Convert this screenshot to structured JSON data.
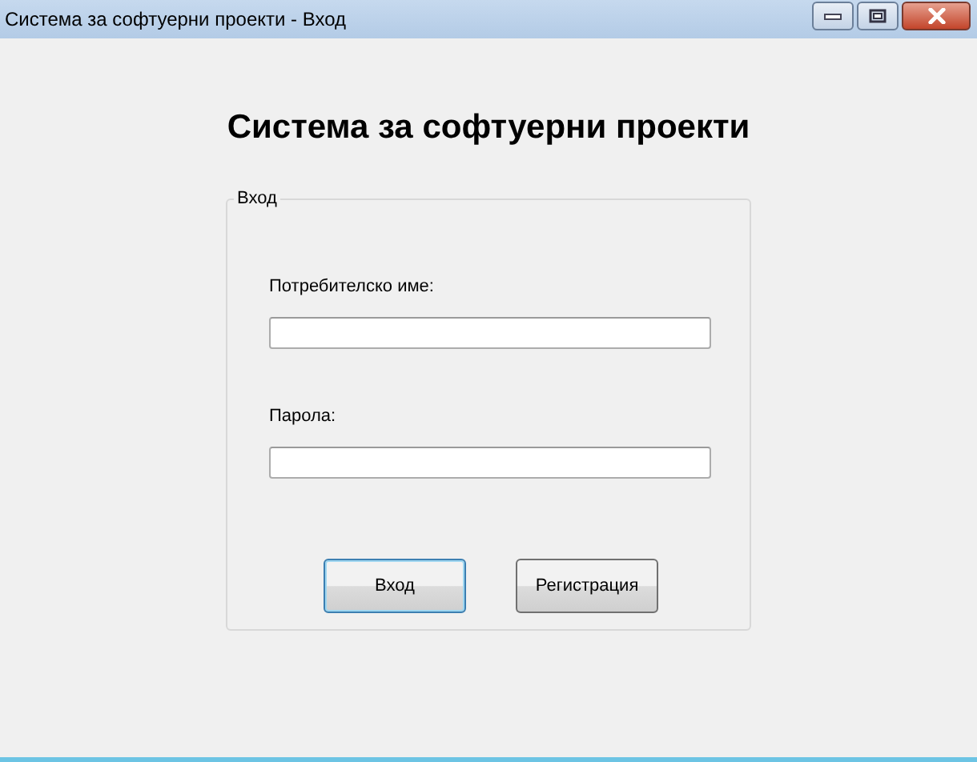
{
  "window": {
    "title": "Система за софтуерни проекти - Вход"
  },
  "heading": "Система за софтуерни проекти",
  "group": {
    "title": "Вход",
    "fields": [
      {
        "label": "Потребителско име:"
      },
      {
        "label": "Парола:"
      }
    ],
    "buttons": [
      {
        "label": "Вход",
        "focused": true
      },
      {
        "label": "Регистрация",
        "focused": false
      }
    ]
  }
}
